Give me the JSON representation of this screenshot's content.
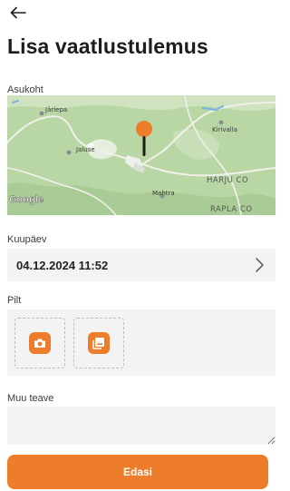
{
  "header": {
    "back_icon": "arrow-left-icon",
    "title": "Lisa vaatlustulemus"
  },
  "location": {
    "label": "Asukoht",
    "map": {
      "places": [
        "Järlepa",
        "Kirivalla",
        "Jaluse",
        "HARJU CO",
        "Mahtra",
        "RAPLA CO"
      ],
      "attribution": "Google",
      "pin_color": "#ee7d2b"
    }
  },
  "date": {
    "label": "Kuupäev",
    "value": "04.12.2024 11:52",
    "chevron_icon": "chevron-right-icon"
  },
  "photo": {
    "label": "Pilt",
    "camera_icon": "camera-icon",
    "gallery_icon": "gallery-icon"
  },
  "other_info": {
    "label": "Muu teave",
    "value": ""
  },
  "submit": {
    "label": "Edasi"
  },
  "colors": {
    "accent": "#ee7d2b",
    "field_bg": "#f3f3f3"
  }
}
